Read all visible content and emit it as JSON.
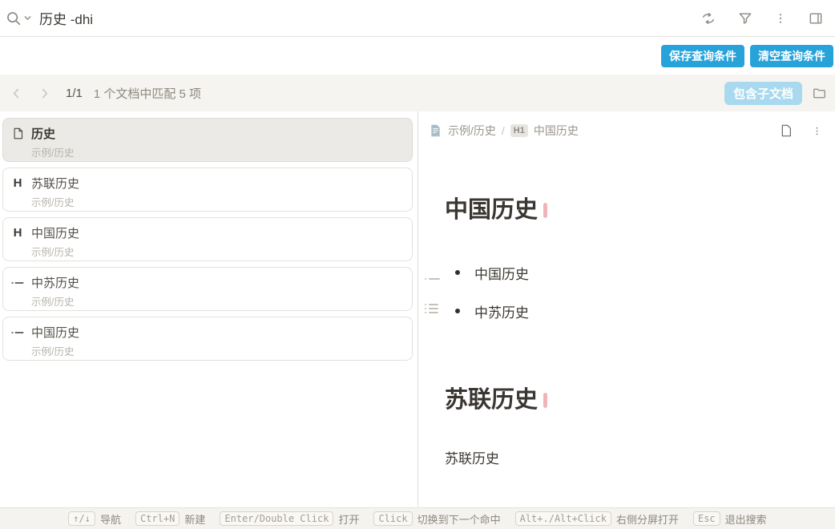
{
  "search": {
    "query": "历史 -dhi",
    "icons": [
      "search-icon",
      "chevron-down-icon",
      "replace-toggle-icon",
      "filter-icon",
      "more-vertical-icon",
      "dock-right-icon"
    ]
  },
  "toolbar": {
    "save_label": "保存查询条件",
    "clear_label": "清空查询条件"
  },
  "nav": {
    "match_position": "1/1",
    "match_summary": "1 个文档中匹配 5 项",
    "include_subdocs_label": "包含子文档",
    "icons": [
      "chevron-left-icon",
      "chevron-right-icon",
      "folder-icon"
    ]
  },
  "results": [
    {
      "icon": "document-icon",
      "title": "历史",
      "path": "示例/历史",
      "selected": true
    },
    {
      "icon": "heading-icon",
      "title": "苏联历史",
      "path": "示例/历史",
      "selected": false
    },
    {
      "icon": "heading-icon",
      "title": "中国历史",
      "path": "示例/历史",
      "selected": false
    },
    {
      "icon": "list-item-icon",
      "title": "中苏历史",
      "path": "示例/历史",
      "selected": false
    },
    {
      "icon": "list-item-icon",
      "title": "中国历史",
      "path": "示例/历史",
      "selected": false
    }
  ],
  "heading_glyph": "H",
  "preview": {
    "breadcrumb": {
      "doc": "示例/历史",
      "separator": "/",
      "level_badge": "H1",
      "current": "中国历史",
      "icons": [
        "document-filled-icon",
        "file-icon",
        "more-vertical-icon"
      ]
    },
    "heading1": "中国历史",
    "list_items": [
      "中国历史",
      "中苏历史"
    ],
    "heading2": "苏联历史",
    "paragraph": "苏联历史"
  },
  "statusbar": {
    "shortcuts": [
      {
        "keys": "↑/↓",
        "label": "导航"
      },
      {
        "keys": "Ctrl+N",
        "label": "新建"
      },
      {
        "keys": "Enter/Double Click",
        "label": "打开"
      },
      {
        "keys": "Click",
        "label": "切换到下一个命中"
      },
      {
        "keys": "Alt+./Alt+Click",
        "label": "右侧分屏打开"
      },
      {
        "keys": "Esc",
        "label": "退出搜索"
      }
    ]
  },
  "colors": {
    "accent_blue": "#28a3da",
    "subdoc_blue": "#a9d9ee",
    "pink_marker": "#f1b3ba",
    "toolbar_bg": "#f6f4f0"
  }
}
